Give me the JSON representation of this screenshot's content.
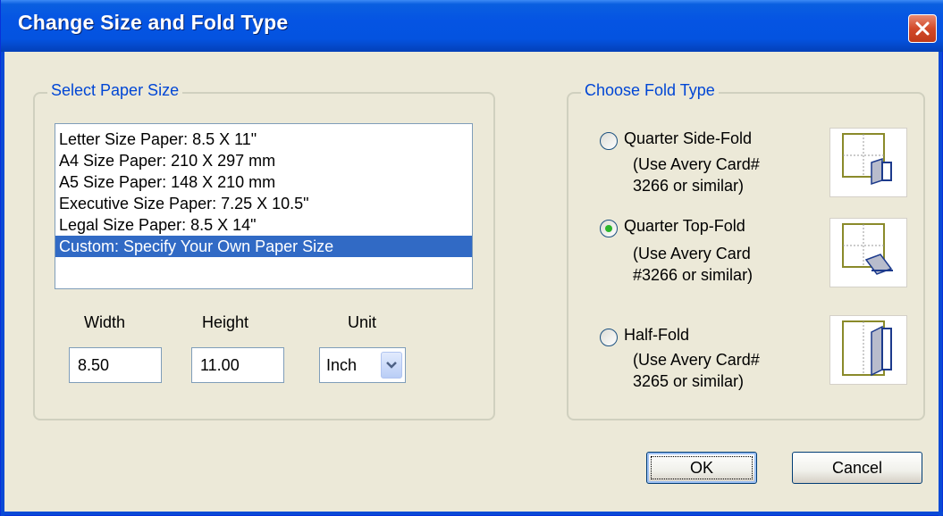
{
  "window": {
    "title": "Change Size and Fold Type"
  },
  "paper_group": {
    "label": "Select Paper Size",
    "items": [
      "Letter Size Paper: 8.5 X 11\"",
      "A4 Size Paper: 210  X 297 mm",
      "A5 Size Paper: 148  X 210 mm",
      "Executive Size Paper: 7.25  X 10.5\"",
      "Legal Size Paper: 8.5 X 14\"",
      "Custom: Specify Your Own Paper Size"
    ],
    "selected_index": 5,
    "width_label": "Width",
    "height_label": "Height",
    "unit_label": "Unit",
    "width_value": "8.50",
    "height_value": "11.00",
    "unit_value": "Inch"
  },
  "fold_group": {
    "label": "Choose Fold Type",
    "options": [
      {
        "label": "Quarter Side-Fold",
        "desc1": "(Use Avery Card#",
        "desc2": "3266 or similar)",
        "checked": false,
        "icon": "quarter-side-fold-icon"
      },
      {
        "label": "Quarter Top-Fold",
        "desc1": "(Use Avery Card",
        "desc2": "#3266 or similar)",
        "checked": true,
        "icon": "quarter-top-fold-icon"
      },
      {
        "label": "Half-Fold",
        "desc1": "(Use Avery Card#",
        "desc2": "3265 or similar)",
        "checked": false,
        "icon": "half-fold-icon"
      }
    ]
  },
  "buttons": {
    "ok": "OK",
    "cancel": "Cancel"
  },
  "colors": {
    "titlebar": "#0554e3",
    "group_label": "#0046d5",
    "selection": "#316ac5",
    "close": "#d24a2a",
    "radio_dot": "#2bb52b"
  }
}
